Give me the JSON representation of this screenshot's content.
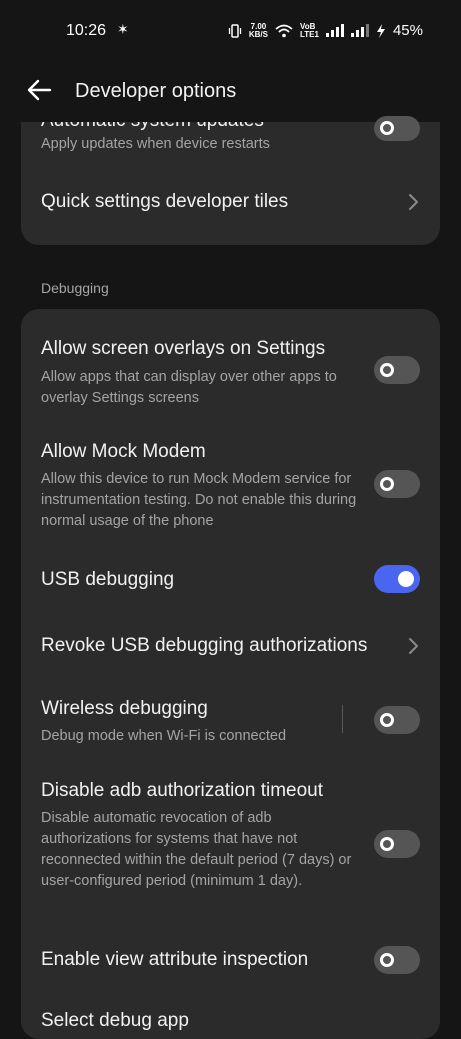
{
  "status_bar": {
    "time": "10:26",
    "net_speed_value": "7.00",
    "net_speed_unit": "KB/S",
    "volte_label_1": "VoB",
    "volte_label_2": "LTE1",
    "battery_percent": "45%",
    "icons": [
      "vibrate-icon",
      "wifi-icon",
      "signal-icon",
      "signal-icon",
      "charging-bolt-icon"
    ]
  },
  "app_bar": {
    "title": "Developer options",
    "back_icon": "back-arrow-icon"
  },
  "top_card": {
    "partial_subtitle": "Apply updates when device restarts",
    "quick_tiles_label": "Quick settings developer tiles"
  },
  "debugging": {
    "section_label": "Debugging",
    "items": [
      {
        "title": "Allow screen overlays on Settings",
        "subtitle": "Allow apps that can display over other apps to overlay Settings screens",
        "toggle_on": false
      },
      {
        "title": "Allow Mock Modem",
        "subtitle": "Allow this device to run Mock Modem service for instrumentation testing. Do not enable this during normal usage of the phone",
        "toggle_on": false
      },
      {
        "title": "USB debugging",
        "toggle_on": true
      },
      {
        "title": "Revoke USB debugging authorizations"
      },
      {
        "title": "Wireless debugging",
        "subtitle": "Debug mode when Wi-Fi is connected",
        "toggle_on": false
      },
      {
        "title": "Disable adb authorization timeout",
        "subtitle": "Disable automatic revocation of adb authorizations for systems that have not reconnected within the default period (7 days) or user-configured period (minimum 1 day).",
        "toggle_on": false
      },
      {
        "title": "Enable view attribute inspection",
        "toggle_on": false
      },
      {
        "title": "Select debug app"
      }
    ]
  },
  "colors": {
    "background": "#151515",
    "card": "#2b2b2b",
    "accent": "#4a66f0",
    "toggle_off": "#555555"
  }
}
